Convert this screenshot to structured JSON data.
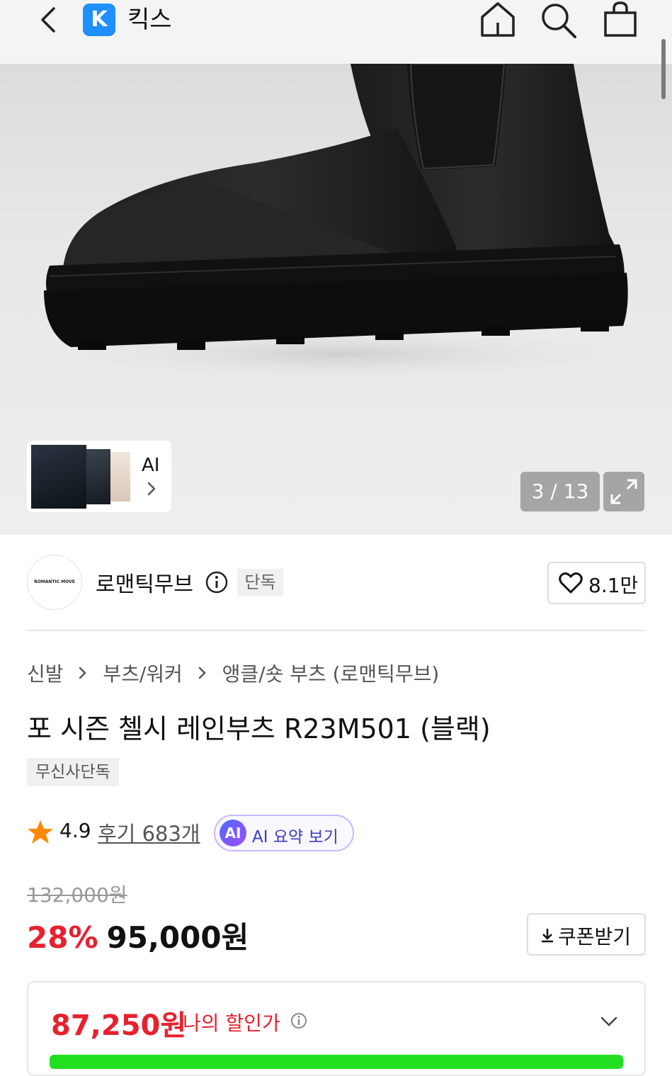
{
  "header": {
    "app_logo_letter": "K",
    "app_name": "킥스"
  },
  "gallery": {
    "ai_label": "AI",
    "current_index": 3,
    "total": 13,
    "counter_text": "3 / 13"
  },
  "brand": {
    "logo_text": "ROMANTIC MOVE",
    "name": "로맨틱무브",
    "exclusive_badge": "단독",
    "likes": "8.1만"
  },
  "breadcrumb": {
    "items": [
      "신발",
      "부츠/워커",
      "앵클/숏 부츠 (로맨틱무브)"
    ]
  },
  "product": {
    "title": "포 시즌 첼시 레인부츠 R23M501 (블랙)",
    "tag": "무신사단독",
    "rating": "4.9",
    "reviews": "후기 683개",
    "ai_badge": "AI",
    "ai_summary": "AI 요약 보기"
  },
  "pricing": {
    "original": "132,000원",
    "discount": "28%",
    "price": "95,000원",
    "coupon_label": "쿠폰받기",
    "my_price": "87,250원",
    "my_price_label": "나의 할인가"
  },
  "colors": {
    "accent_red": "#e8202e",
    "accent_green": "#22e020",
    "app_blue": "#1e90ff",
    "star": "#ff8a00"
  }
}
